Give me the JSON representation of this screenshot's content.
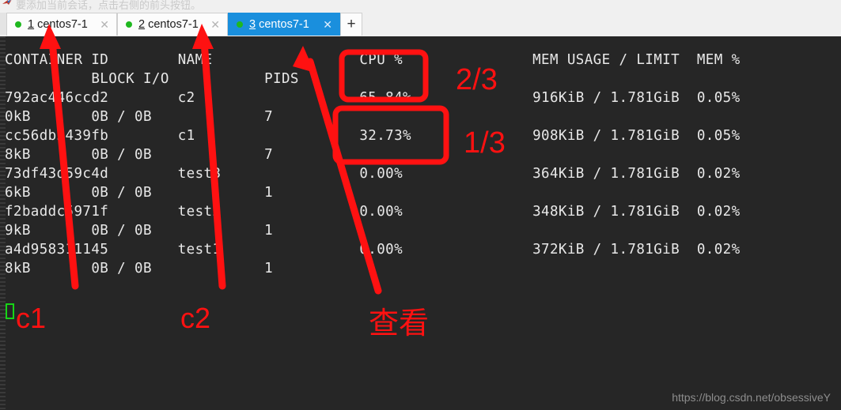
{
  "hint": {
    "text": "要添加当前会话，点击右侧的前头按钮。",
    "pin_icon": "pin-icon"
  },
  "tabs": {
    "items": [
      {
        "num": "1",
        "name": " centos7-1",
        "status_icon": "green-dot-icon",
        "close_icon": "close-icon",
        "active": false
      },
      {
        "num": "2",
        "name": " centos7-1",
        "status_icon": "green-dot-icon",
        "close_icon": "close-icon",
        "active": false
      },
      {
        "num": "3",
        "name": " centos7-1",
        "status_icon": "green-dot-icon",
        "close_icon": "close-icon",
        "active": true
      }
    ],
    "new_tab_label": "+",
    "active_color": "#1a8fdd"
  },
  "terminal": {
    "headers_line1": [
      "CONTAINER ID",
      "NAME",
      "CPU %",
      "MEM USAGE / LIMIT",
      "MEM %"
    ],
    "headers_line2": [
      "BLOCK I/O",
      "PIDS"
    ],
    "rows": [
      {
        "container_id": "792ac446ccd2",
        "name": "c2",
        "cpu": "65.84%",
        "mem_usage": "916KiB / 1.781GiB",
        "mem_pct": "0.05%",
        "net_io": "0kB",
        "block_io": "0B / 0B",
        "pids": "7"
      },
      {
        "container_id": "cc56db5439fb",
        "name": "c1",
        "cpu": "32.73%",
        "mem_usage": "908KiB / 1.781GiB",
        "mem_pct": "0.05%",
        "net_io": "8kB",
        "block_io": "0B / 0B",
        "pids": "7"
      },
      {
        "container_id": "73df43d59c4d",
        "name": "test3",
        "cpu": "0.00%",
        "mem_usage": "364KiB / 1.781GiB",
        "mem_pct": "0.02%",
        "net_io": "6kB",
        "block_io": "0B / 0B",
        "pids": "1"
      },
      {
        "container_id": "f2baddc5971f",
        "name": "test2",
        "cpu": "0.00%",
        "mem_usage": "348KiB / 1.781GiB",
        "mem_pct": "0.02%",
        "net_io": "9kB",
        "block_io": "0B / 0B",
        "pids": "1"
      },
      {
        "container_id": "a4d958311145",
        "name": "test1",
        "cpu": "0.00%",
        "mem_usage": "372KiB / 1.781GiB",
        "mem_pct": "0.02%",
        "net_io": "8kB",
        "block_io": "0B / 0B",
        "pids": "1"
      }
    ],
    "cursor_icon": "block-cursor-icon"
  },
  "annotations": {
    "color": "#ff1111",
    "fraction_top": "2/3",
    "fraction_bottom": "1/3",
    "label_c1": "c1",
    "label_c2": "c2",
    "label_view": "查看",
    "arrow_1_icon": "arrow-up-icon",
    "arrow_2_icon": "arrow-up-icon",
    "arrow_3_icon": "arrow-up-icon",
    "box_cpu_top_icon": "highlight-box-icon",
    "box_cpu_bottom_icon": "highlight-box-icon"
  },
  "watermark": {
    "text": "https://blog.csdn.net/obsessiveY"
  }
}
